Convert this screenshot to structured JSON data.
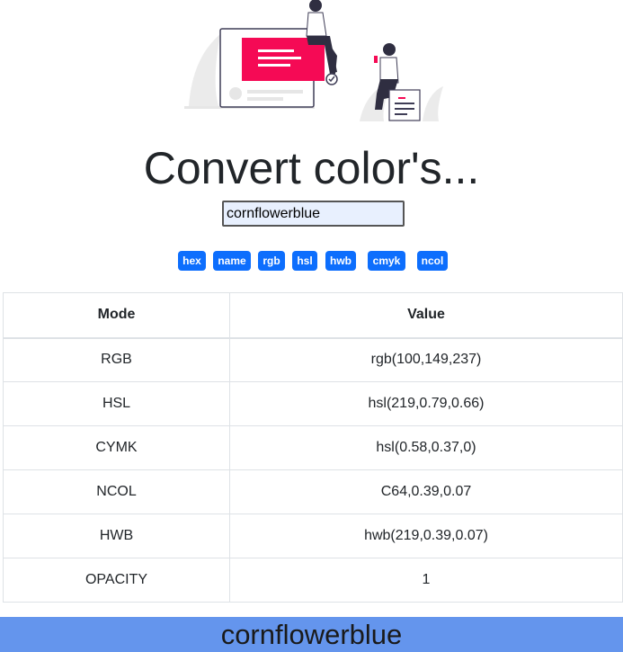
{
  "page": {
    "title": "Convert color's...",
    "input_value": "cornflowerblue"
  },
  "buttons": [
    "hex",
    "name",
    "rgb",
    "hsl",
    "hwb",
    "cmyk",
    "ncol"
  ],
  "table": {
    "headers": [
      "Mode",
      "Value"
    ],
    "rows": [
      [
        "RGB",
        "rgb(100,149,237)"
      ],
      [
        "HSL",
        "hsl(219,0.79,0.66)"
      ],
      [
        "CYMK",
        "hsl(0.58,0.37,0)"
      ],
      [
        "NCOL",
        "C64,0.39,0.07"
      ],
      [
        "HWB",
        "hwb(219,0.39,0.07)"
      ],
      [
        "OPACITY",
        "1"
      ]
    ]
  },
  "swatch": {
    "label": "cornflowerblue",
    "color": "#6495ed"
  },
  "colors": {
    "button_blue": "#0d6efd",
    "hero_accent": "#f50a55",
    "hero_dark": "#2f2e41"
  }
}
